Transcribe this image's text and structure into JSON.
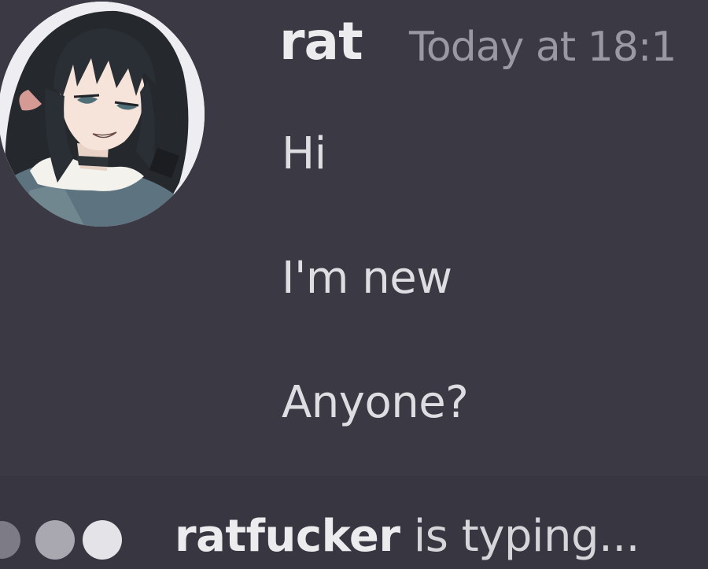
{
  "message": {
    "author": "rat",
    "timestamp": "Today at 18:1",
    "lines": [
      "Hi",
      "I'm new",
      "Anyone?"
    ]
  },
  "typing": {
    "user": "ratfucker",
    "suffix": " is typing..."
  },
  "icons": {
    "avatar": "anime-avatar",
    "typing_indicator": "typing-dots-icon"
  },
  "colors": {
    "background": "#3a3944",
    "username": "#ececef",
    "timestamp": "#9a99a3",
    "message_text": "#dedde2"
  }
}
